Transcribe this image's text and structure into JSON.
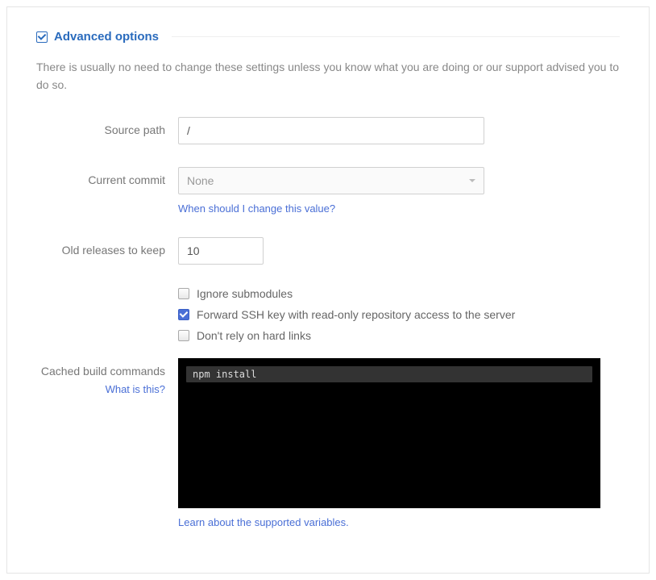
{
  "header": {
    "title": "Advanced options"
  },
  "description": "There is usually no need to change these settings unless you know what you are doing or our support advised you to do so.",
  "fields": {
    "source_path": {
      "label": "Source path",
      "value": "/"
    },
    "current_commit": {
      "label": "Current commit",
      "value": "None",
      "hint": "When should I change this value?"
    },
    "old_releases": {
      "label": "Old releases to keep",
      "value": "10"
    },
    "checks": {
      "ignore_submodules": {
        "label": "Ignore submodules",
        "checked": false
      },
      "forward_ssh": {
        "label": "Forward SSH key with read-only repository access to the server",
        "checked": true
      },
      "no_hard_links": {
        "label": "Don't rely on hard links",
        "checked": false
      }
    },
    "cached_build": {
      "label": "Cached build commands",
      "hint": "What is this?",
      "command": "npm install",
      "footer_link": "Learn about the supported variables."
    }
  }
}
